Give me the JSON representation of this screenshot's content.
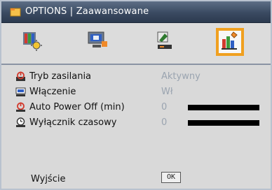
{
  "window": {
    "title": "OPTIONS | Zaawansowane"
  },
  "toolbar": {
    "tabs": [
      {
        "name": "image-settings-icon"
      },
      {
        "name": "display-settings-icon"
      },
      {
        "name": "setup-settings-icon"
      },
      {
        "name": "options-icon",
        "selected": true
      }
    ]
  },
  "menu": {
    "items": [
      {
        "label": "Tryb zasilania",
        "value": "Aktywny",
        "icon": "power-icon"
      },
      {
        "label": "Włączenie",
        "value": "Wł",
        "icon": "direct-power-on-icon"
      },
      {
        "label": "Auto Power Off (min)",
        "value": "0",
        "icon": "auto-power-off-icon",
        "level": 0
      },
      {
        "label": "Wyłącznik czasowy",
        "value": "0",
        "icon": "sleep-timer-icon",
        "level": 0
      }
    ],
    "exit_label": "Wyjście",
    "ok_label": "OK"
  },
  "colors": {
    "accent": "#f0a020",
    "title_bg": "#3a4a61",
    "value_text": "#9aa4b0"
  }
}
